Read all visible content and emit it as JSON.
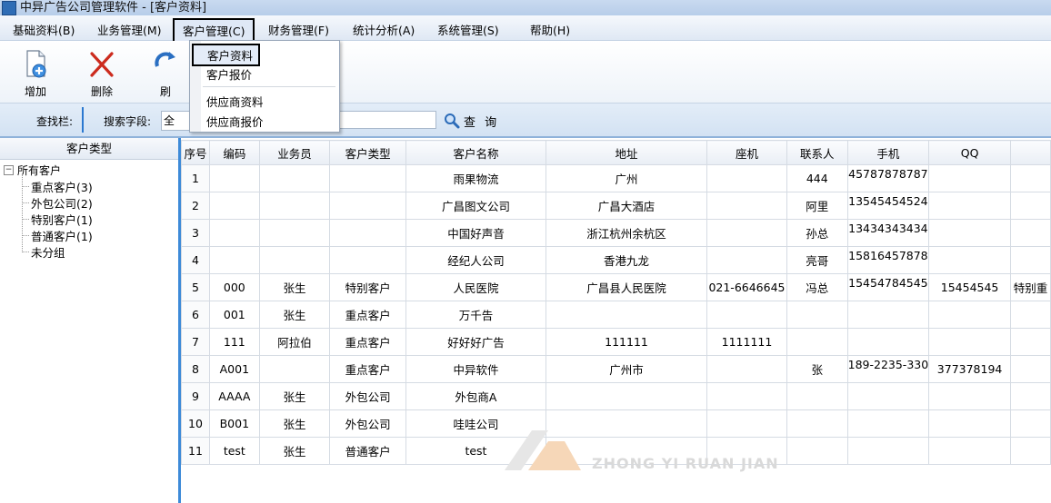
{
  "window": {
    "title": "中异广告公司管理软件 - [客户资料]"
  },
  "menu": [
    {
      "label": "基础资料(B)"
    },
    {
      "label": "业务管理(M)"
    },
    {
      "label": "客户管理(C)"
    },
    {
      "label": "财务管理(F)"
    },
    {
      "label": "统计分析(A)"
    },
    {
      "label": "系统管理(S)"
    },
    {
      "label": "帮助(H)"
    }
  ],
  "dropdown": [
    {
      "label": "客户资料"
    },
    {
      "label": "客户报价"
    },
    {
      "label": "供应商资料"
    },
    {
      "label": "供应商报价"
    }
  ],
  "toolbar": {
    "add_label": "增加",
    "delete_label": "删除",
    "refresh_label": "刷"
  },
  "search": {
    "bar_label": "查找栏:",
    "field_label": "搜索字段:",
    "field_value": "全",
    "button_label": "查 询"
  },
  "tree": {
    "header": "客户类型",
    "root": "所有客户",
    "nodes": [
      {
        "label": "重点客户(3)"
      },
      {
        "label": "外包公司(2)"
      },
      {
        "label": "特别客户(1)"
      },
      {
        "label": "普通客户(1)"
      },
      {
        "label": "未分组"
      }
    ]
  },
  "table": {
    "columns": [
      "序号",
      "编码",
      "业务员",
      "客户类型",
      "客户名称",
      "地址",
      "座机",
      "联系人",
      "手机",
      "QQ",
      ""
    ],
    "rows": [
      [
        "1",
        "",
        "",
        "",
        "雨果物流",
        "广州",
        "",
        "444",
        "45787878787",
        "",
        ""
      ],
      [
        "2",
        "",
        "",
        "",
        "广昌图文公司",
        "广昌大酒店",
        "",
        "阿里",
        "13545454524",
        "",
        ""
      ],
      [
        "3",
        "",
        "",
        "",
        "中国好声音",
        "浙江杭州余杭区",
        "",
        "孙总",
        "13434343434",
        "",
        ""
      ],
      [
        "4",
        "",
        "",
        "",
        "经纪人公司",
        "香港九龙",
        "",
        "亮哥",
        "15816457878",
        "",
        ""
      ],
      [
        "5",
        "000",
        "张生",
        "特别客户",
        "人民医院",
        "广昌县人民医院",
        "021-6646645",
        "冯总",
        "15454784545",
        "15454545",
        "特别重"
      ],
      [
        "6",
        "001",
        "张生",
        "重点客户",
        "万千告",
        "",
        "",
        "",
        "",
        "",
        ""
      ],
      [
        "7",
        "111",
        "阿拉伯",
        "重点客户",
        "好好好广告",
        "111111",
        "1111111",
        "",
        "",
        "",
        ""
      ],
      [
        "8",
        "A001",
        "",
        "重点客户",
        "中异软件",
        "广州市",
        "",
        "张",
        "189-2235-330",
        "377378194",
        ""
      ],
      [
        "9",
        "AAAA",
        "张生",
        "外包公司",
        "外包商A",
        "",
        "",
        "",
        "",
        "",
        ""
      ],
      [
        "10",
        "B001",
        "张生",
        "外包公司",
        "哇哇公司",
        "",
        "",
        "",
        "",
        "",
        ""
      ],
      [
        "11",
        "test",
        "张生",
        "普通客户",
        "test",
        "",
        "",
        "",
        "",
        "",
        ""
      ]
    ]
  },
  "watermark": {
    "text": "ZHONG YI RUAN JIAN"
  }
}
